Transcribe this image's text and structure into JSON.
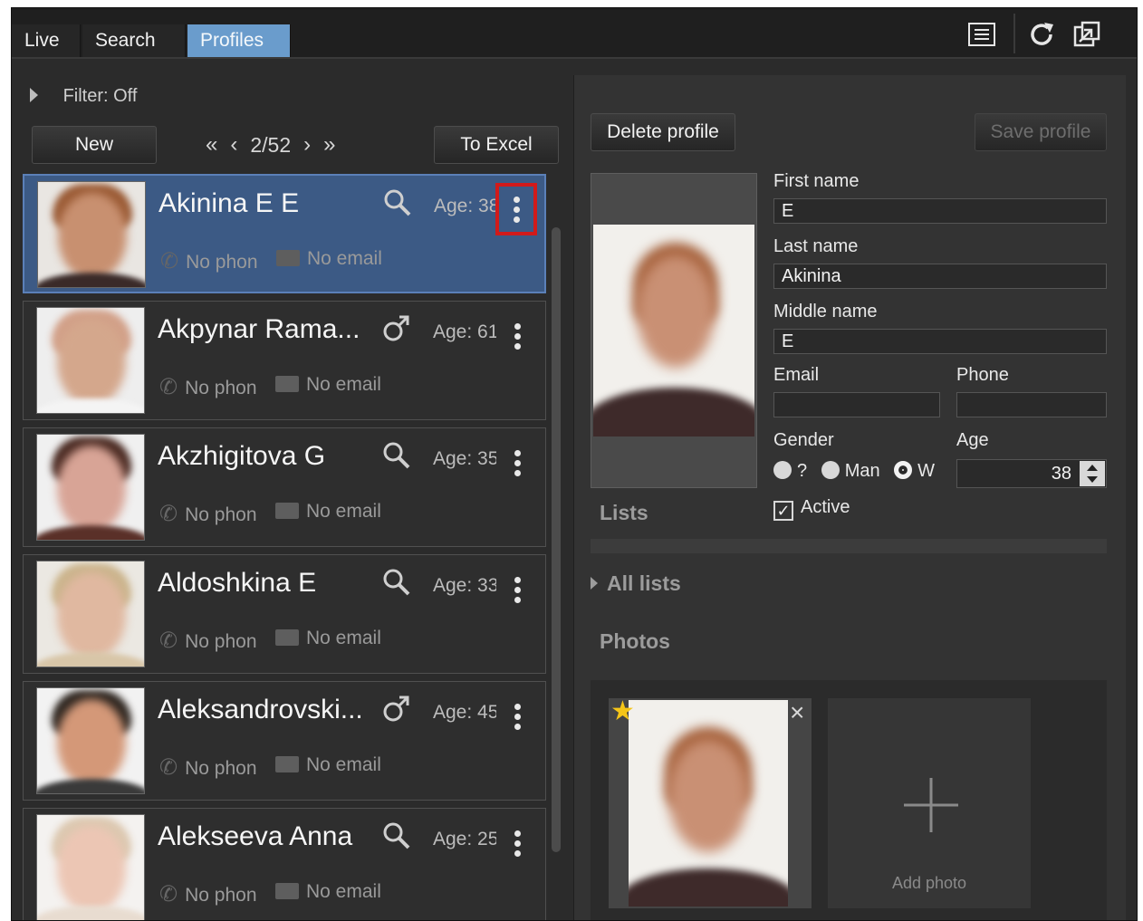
{
  "tabs": [
    {
      "label": "Live"
    },
    {
      "label": "Search"
    },
    {
      "label": "Profiles"
    }
  ],
  "toolbar": {
    "list_icon": "list-icon",
    "refresh_icon": "refresh-icon",
    "popout_icon": "popout-icon"
  },
  "filter": {
    "label": "Filter:",
    "value": "Off"
  },
  "list_controls": {
    "new_label": "New",
    "first": "«",
    "prev": "‹",
    "page": "2/52",
    "next": "›",
    "last": "»",
    "excel_label": "To Excel"
  },
  "profiles": [
    {
      "name": "Akinina E E",
      "icon": "search-face-icon",
      "age": "Age: 38",
      "phone": "No phon",
      "email": "No email",
      "selected": true
    },
    {
      "name": "Akpynar Rama...",
      "icon": "male-icon",
      "age": "Age: 61",
      "phone": "No phon",
      "email": "No email"
    },
    {
      "name": "Akzhigitova G",
      "icon": "search-face-icon",
      "age": "Age: 35",
      "phone": "No phon",
      "email": "No email"
    },
    {
      "name": "Aldoshkina E",
      "icon": "search-face-icon",
      "age": "Age: 33",
      "phone": "No phon",
      "email": "No email"
    },
    {
      "name": "Aleksandrovski...",
      "icon": "male-icon",
      "age": "Age: 45",
      "phone": "No phon",
      "email": "No email"
    },
    {
      "name": "Alekseeva Anna",
      "icon": "search-face-icon",
      "age": "Age: 25",
      "phone": "No phon",
      "email": "No email"
    }
  ],
  "detail": {
    "delete_label": "Delete profile",
    "save_label": "Save profile",
    "first_name_label": "First name",
    "first_name": "E",
    "last_name_label": "Last name",
    "last_name": "Akinina",
    "middle_name_label": "Middle name",
    "middle_name": "E",
    "email_label": "Email",
    "email": "",
    "phone_label": "Phone",
    "phone": "",
    "gender_label": "Gender",
    "gender_unknown": "?",
    "gender_man": "Man",
    "gender_woman": "W",
    "age_label": "Age",
    "age": "38",
    "active_label": "Active",
    "lists_title": "Lists",
    "all_lists": "All lists",
    "photos_title": "Photos",
    "add_photo": "Add photo"
  },
  "colors": {
    "accent_tab": "#6a9ccc",
    "selected_row": "#3c5a85",
    "highlight_box": "#d11a1a",
    "star": "#f5c518"
  }
}
